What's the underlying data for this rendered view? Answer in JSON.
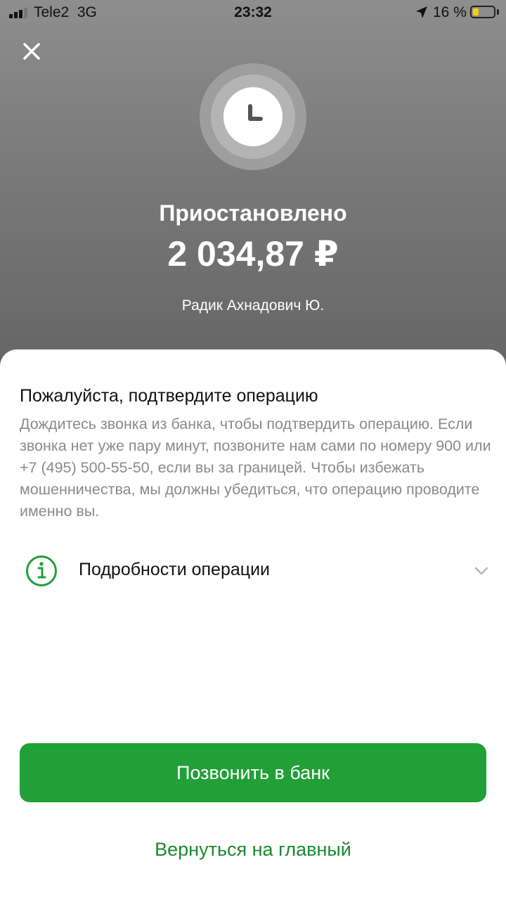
{
  "status_bar": {
    "carrier": "Tele2",
    "network": "3G",
    "time": "23:32",
    "battery_percent": "16 %",
    "battery_level": 0.16,
    "signal_bars": 3
  },
  "header": {
    "status_title": "Приостановлено",
    "amount": "2 034,87 ₽",
    "recipient": "Радик Ахнадович Ю.",
    "status_icon": "clock-icon"
  },
  "sheet": {
    "title": "Пожалуйста, подтвердите операцию",
    "description": "Дождитесь звонка из банка, чтобы подтвердить операцию. Если звонка нет уже пару минут, позвоните нам сами по номеру 900 или +7 (495) 500-55-50, если вы за границей. Чтобы избежать мошенничества, мы должны убедиться, что операцию проводите именно вы.",
    "details_label": "Подробности операции",
    "details_icon": "info-icon"
  },
  "actions": {
    "call_bank": "Позвонить в банк",
    "go_home": "Вернуться на главный"
  },
  "colors": {
    "accent": "#21a038",
    "link": "#1a8a2e"
  }
}
